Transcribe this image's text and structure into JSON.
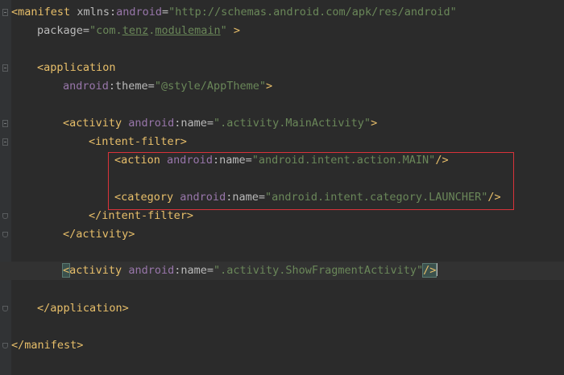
{
  "editor": {
    "lines": [
      {
        "id": "manifest-open",
        "tokens": [
          {
            "t": "<",
            "c": "tag"
          },
          {
            "t": "manifest",
            "c": "tag"
          },
          {
            "t": " ",
            "c": "plain"
          },
          {
            "t": "xmlns",
            "c": "attr"
          },
          {
            "t": ":",
            "c": "attr"
          },
          {
            "t": "android",
            "c": "ns"
          },
          {
            "t": "=",
            "c": "attr"
          },
          {
            "t": "\"http://schemas.android.com/apk/res/android\"",
            "c": "val"
          }
        ]
      },
      {
        "id": "package-attr",
        "tokens": [
          {
            "t": "package",
            "c": "attr"
          },
          {
            "t": "=",
            "c": "attr"
          },
          {
            "t": "\"com.",
            "c": "val"
          },
          {
            "t": "tenz",
            "c": "val link"
          },
          {
            "t": ".",
            "c": "val"
          },
          {
            "t": "modulemain",
            "c": "val link"
          },
          {
            "t": "\"",
            "c": "val"
          },
          {
            "t": " >",
            "c": "tag"
          }
        ]
      },
      {
        "id": "blank-1",
        "tokens": []
      },
      {
        "id": "application-open",
        "tokens": [
          {
            "t": "<application",
            "c": "tag"
          }
        ]
      },
      {
        "id": "theme-attr",
        "tokens": [
          {
            "t": "android",
            "c": "ns"
          },
          {
            "t": ":theme=",
            "c": "attr"
          },
          {
            "t": "\"@style/AppTheme\"",
            "c": "val"
          },
          {
            "t": ">",
            "c": "tag"
          }
        ]
      },
      {
        "id": "blank-2",
        "tokens": []
      },
      {
        "id": "activity-main-open",
        "tokens": [
          {
            "t": "<activity",
            "c": "tag"
          },
          {
            "t": " ",
            "c": "plain"
          },
          {
            "t": "android",
            "c": "ns"
          },
          {
            "t": ":name=",
            "c": "attr"
          },
          {
            "t": "\".activity.MainActivity\"",
            "c": "val"
          },
          {
            "t": ">",
            "c": "tag"
          }
        ]
      },
      {
        "id": "intent-filter-open",
        "tokens": [
          {
            "t": "<intent-filter>",
            "c": "tag"
          }
        ]
      },
      {
        "id": "action-main",
        "tokens": [
          {
            "t": "<action",
            "c": "tag"
          },
          {
            "t": " ",
            "c": "plain"
          },
          {
            "t": "android",
            "c": "ns"
          },
          {
            "t": ":name=",
            "c": "attr"
          },
          {
            "t": "\"android.intent.action.MAIN\"",
            "c": "val"
          },
          {
            "t": "/>",
            "c": "tag"
          }
        ]
      },
      {
        "id": "blank-3",
        "tokens": []
      },
      {
        "id": "category-launcher",
        "tokens": [
          {
            "t": "<category",
            "c": "tag"
          },
          {
            "t": " ",
            "c": "plain"
          },
          {
            "t": "android",
            "c": "ns"
          },
          {
            "t": ":name=",
            "c": "attr"
          },
          {
            "t": "\"android.intent.category.LAUNCHER\"",
            "c": "val"
          },
          {
            "t": "/>",
            "c": "tag"
          }
        ]
      },
      {
        "id": "intent-filter-close",
        "tokens": [
          {
            "t": "</intent-filter>",
            "c": "tag"
          }
        ]
      },
      {
        "id": "activity-main-close",
        "tokens": [
          {
            "t": "</activity>",
            "c": "tag"
          }
        ]
      },
      {
        "id": "blank-4",
        "tokens": []
      },
      {
        "id": "activity-fragment",
        "tokens": [
          {
            "t": "<",
            "c": "tag bracket-hl"
          },
          {
            "t": "activity",
            "c": "tag"
          },
          {
            "t": " ",
            "c": "plain"
          },
          {
            "t": "android",
            "c": "ns"
          },
          {
            "t": ":name=",
            "c": "attr"
          },
          {
            "t": "\".activity.ShowFragmentActivity\"",
            "c": "val"
          },
          {
            "t": "/>",
            "c": "tag bracket-hl"
          }
        ]
      },
      {
        "id": "blank-5",
        "tokens": []
      },
      {
        "id": "application-close",
        "tokens": [
          {
            "t": "</application>",
            "c": "tag"
          }
        ]
      },
      {
        "id": "blank-6",
        "tokens": []
      },
      {
        "id": "manifest-close",
        "tokens": [
          {
            "t": "</manifest>",
            "c": "tag"
          }
        ]
      }
    ]
  }
}
